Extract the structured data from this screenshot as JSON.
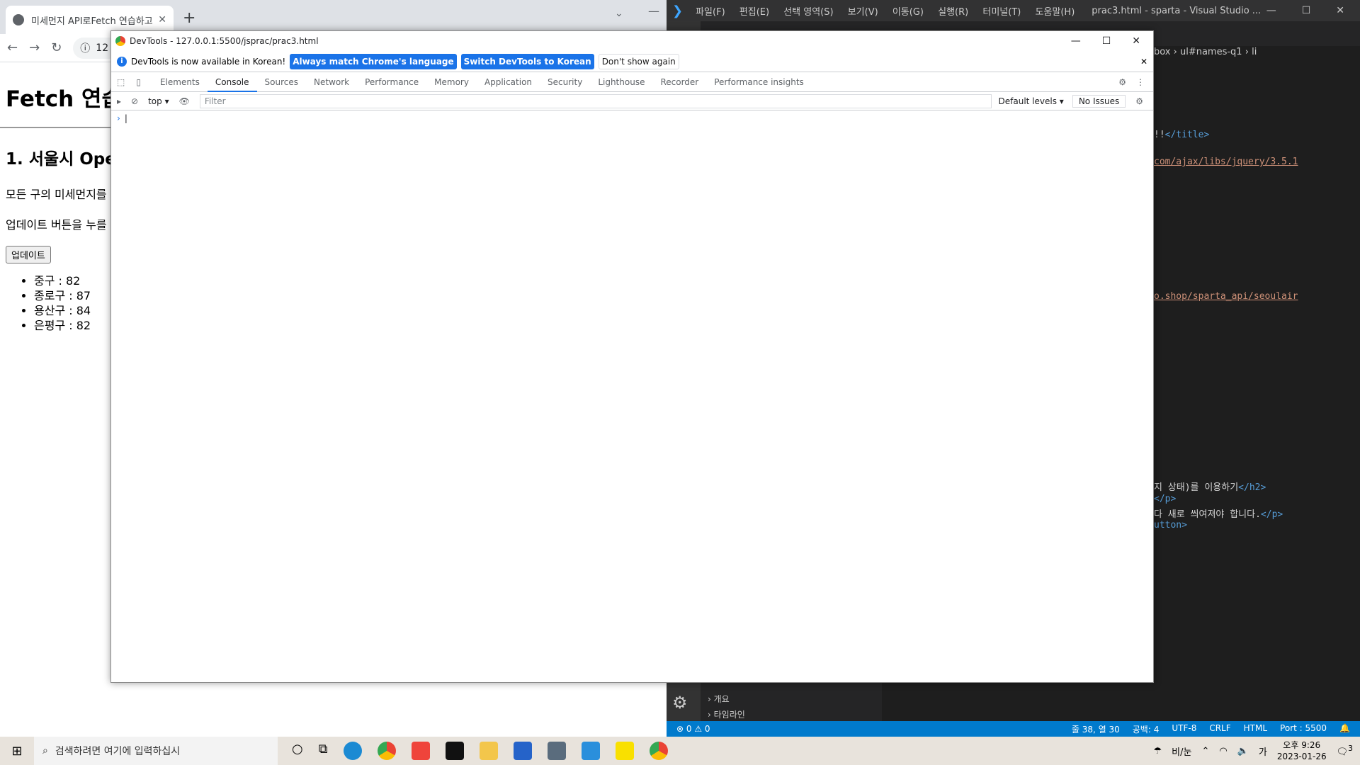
{
  "chrome": {
    "tab_title": "미세먼지 API로Fetch 연습하고",
    "address_partial": "12",
    "page": {
      "h1": "Fetch 연습",
      "h2": "1. 서울시 Ope",
      "p1": "모든 구의 미세먼지를",
      "p2": "업데이트 버튼을 누를",
      "button": "업데이트",
      "items": [
        "중구 : 82",
        "종로구 : 87",
        "용산구 : 84",
        "은평구 : 82"
      ]
    }
  },
  "devtools": {
    "title": "DevTools - 127.0.0.1:5500/jsprac/prac3.html",
    "info_text": "DevTools is now available in Korean!",
    "btn_match": "Always match Chrome's language",
    "btn_switch": "Switch DevTools to Korean",
    "btn_dismiss": "Don't show again",
    "tabs": [
      "Elements",
      "Console",
      "Sources",
      "Network",
      "Performance",
      "Memory",
      "Application",
      "Security",
      "Lighthouse",
      "Recorder",
      "Performance insights"
    ],
    "active_tab": "Console",
    "context": "top",
    "filter_placeholder": "Filter",
    "levels": "Default levels",
    "issues": "No Issues"
  },
  "vscode": {
    "menu": [
      "파일(F)",
      "편집(E)",
      "선택 영역(S)",
      "보기(V)",
      "이동(G)",
      "실행(R)",
      "터미널(T)",
      "도움말(H)"
    ],
    "window_title": "prac3.html - sparta - Visual Studio ...",
    "breadcrumb_1": "box",
    "breadcrumb_2": "ul#names-q1",
    "breadcrumb_3": "li",
    "code": {
      "l1_text": "!!",
      "l1_tag": "</title>",
      "l2": "com/ajax/libs/jquery/3.5.1",
      "l3": "o.shop/sparta_api/seoulair",
      "l4_text": "지 상태)를 이용하기",
      "l4_tag": "</h2>",
      "l5_tag": "</p>",
      "l6_text": "다 새로 씌여져야 합니다.",
      "l6_tag": "</p>",
      "l7": "utton>"
    },
    "outline": "개요",
    "timeline": "타임라인",
    "status": {
      "problems": "⊗ 0 ⚠ 0",
      "position": "줄 38, 열 30",
      "spaces": "공백: 4",
      "encoding": "UTF-8",
      "eol": "CRLF",
      "lang": "HTML",
      "port": "Port : 5500"
    }
  },
  "taskbar": {
    "search_placeholder": "검색하려면 여기에 입력하십시",
    "weather": "비/눈",
    "ime": "가",
    "time": "오후 9:26",
    "date": "2023-01-26",
    "notifications": "3"
  }
}
